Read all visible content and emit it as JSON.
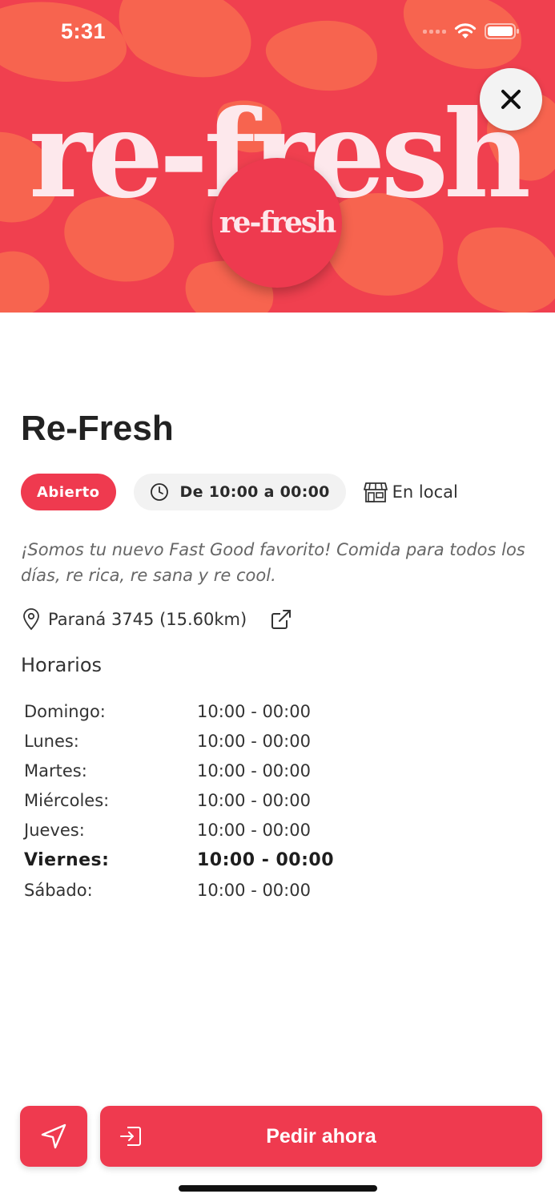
{
  "status_bar": {
    "time": "5:31"
  },
  "hero": {
    "wordmark": "re-fresh",
    "logo_text": "re-fresh",
    "background_color": "#f0404f",
    "blob_color": "#f7644f"
  },
  "store": {
    "name": "Re-Fresh",
    "status": "Abierto",
    "hours_chip": "De 10:00 a 00:00",
    "service_type": "En local",
    "description": "¡Somos tu nuevo Fast Good favorito! Comida para todos los días, re rica, re sana y re cool.",
    "address": "Paraná 3745 (15.60km)"
  },
  "hours": {
    "title": "Horarios",
    "rows": [
      {
        "day": "Domingo:",
        "time": "10:00 - 00:00"
      },
      {
        "day": "Lunes:",
        "time": "10:00 - 00:00"
      },
      {
        "day": "Martes:",
        "time": "10:00 - 00:00"
      },
      {
        "day": "Miércoles:",
        "time": "10:00 - 00:00"
      },
      {
        "day": "Jueves:",
        "time": "10:00 - 00:00"
      },
      {
        "day": "Viernes:",
        "time": "10:00 - 00:00"
      },
      {
        "day": "Sábado:",
        "time": "10:00 - 00:00"
      }
    ]
  },
  "actions": {
    "order_label": "Pedir ahora"
  },
  "colors": {
    "accent": "#ef3a4f",
    "chip_bg": "#f2f2f2",
    "text": "#222222"
  },
  "icons": [
    "close-icon",
    "clock-icon",
    "store-icon",
    "location-pin-icon",
    "external-link-icon",
    "navigation-arrow-icon",
    "enter-icon",
    "wifi-icon",
    "battery-icon"
  ]
}
